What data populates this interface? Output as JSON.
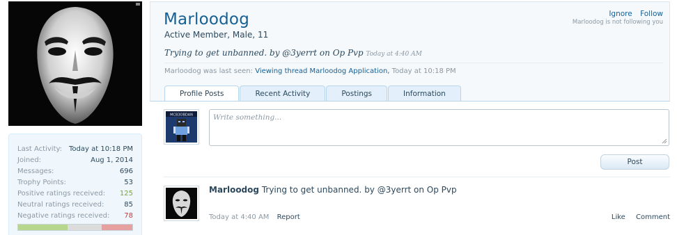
{
  "profile": {
    "name": "Marloodog",
    "subtitle": "Active Member, Male, 11",
    "status": "Trying to get unbanned. by @3yerrt on Op Pvp",
    "status_time": "Today at 4:40 AM",
    "last_seen_prefix": "Marloodog was last seen:",
    "last_seen_activity": "Viewing thread Marloodog Application,",
    "last_seen_time": "Today at 10:18 PM"
  },
  "follow": {
    "ignore_label": "Ignore",
    "follow_label": "Follow",
    "note": "Marloodog is not following you"
  },
  "stats": [
    {
      "label": "Last Activity:",
      "value": "Today at 10:18 PM"
    },
    {
      "label": "Joined:",
      "value": "Aug 1, 2014"
    },
    {
      "label": "Messages:",
      "value": "696"
    },
    {
      "label": "Trophy Points:",
      "value": "53"
    },
    {
      "label": "Positive ratings received:",
      "value": "125"
    },
    {
      "label": "Neutral ratings received:",
      "value": "85"
    },
    {
      "label": "Negative ratings received:",
      "value": "78"
    }
  ],
  "rating_bar": {
    "positive": 125,
    "neutral": 85,
    "negative": 78,
    "colors": {
      "positive": "#b7d78f",
      "neutral": "#dcdcdc",
      "negative": "#e6a0a0"
    }
  },
  "tabs": [
    "Profile Posts",
    "Recent Activity",
    "Postings",
    "Information"
  ],
  "composer": {
    "placeholder": "Write something...",
    "post_label": "Post"
  },
  "message": {
    "author": "Marloodog",
    "text": "Trying to get unbanned. by @3yerrt on Op Pvp",
    "time": "Today at 4:40 AM",
    "report_label": "Report",
    "like_label": "Like",
    "comment_label": "Comment"
  },
  "composer_avatar_caption": "MCB3OBDAN",
  "colors": {
    "link": "#176093",
    "panel": "#f5f9fc",
    "muted": "#8b98a3"
  }
}
